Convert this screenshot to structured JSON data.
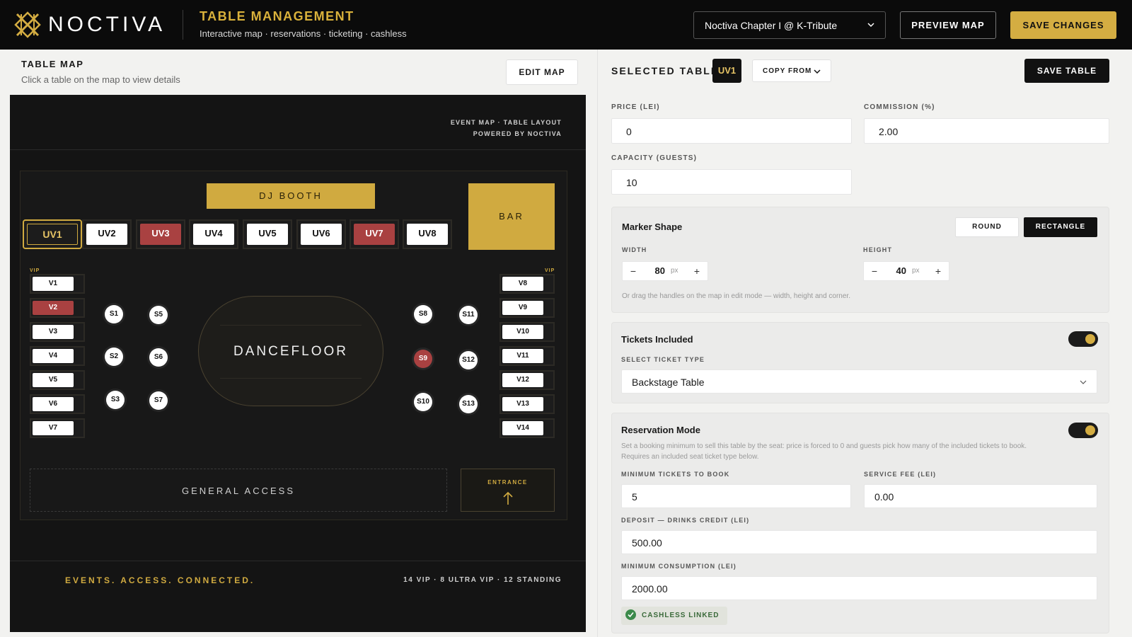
{
  "header": {
    "brand": "NOCTIVA",
    "title": "TABLE MANAGEMENT",
    "subtitle": "Interactive map · reservations · ticketing · cashless",
    "event_select": "Noctiva Chapter I @ K-Tribute",
    "preview_label": "PREVIEW MAP",
    "save_label": "SAVE CHANGES"
  },
  "map_panel": {
    "title": "TABLE MAP",
    "subtitle": "Click a table on the map to view details",
    "edit_label": "EDIT MAP",
    "map_header_line1": "EVENT MAP · TABLE LAYOUT",
    "map_header_line2": "POWERED BY NOCTIVA",
    "dj_booth": "DJ BOOTH",
    "bar": "BAR",
    "vip_label": "VIP",
    "dancefloor": "DANCEFLOOR",
    "general_access": "GENERAL ACCESS",
    "entrance": "ENTRANCE",
    "tagline": "EVENTS. ACCESS. CONNECTED.",
    "stats": "14 VIP · 8 ULTRA VIP · 12 STANDING",
    "ultra_vip": [
      {
        "label": "UV1",
        "status": "selected"
      },
      {
        "label": "UV2",
        "status": "available"
      },
      {
        "label": "UV3",
        "status": "reserved"
      },
      {
        "label": "UV4",
        "status": "available"
      },
      {
        "label": "UV5",
        "status": "available"
      },
      {
        "label": "UV6",
        "status": "available"
      },
      {
        "label": "UV7",
        "status": "reserved"
      },
      {
        "label": "UV8",
        "status": "available"
      }
    ],
    "vip_left": [
      {
        "label": "V1",
        "status": "available"
      },
      {
        "label": "V2",
        "status": "reserved"
      },
      {
        "label": "V3",
        "status": "available"
      },
      {
        "label": "V4",
        "status": "available"
      },
      {
        "label": "V5",
        "status": "available"
      },
      {
        "label": "V6",
        "status": "available"
      },
      {
        "label": "V7",
        "status": "available"
      }
    ],
    "vip_right": [
      {
        "label": "V8",
        "status": "available"
      },
      {
        "label": "V9",
        "status": "available"
      },
      {
        "label": "V10",
        "status": "available"
      },
      {
        "label": "V11",
        "status": "available"
      },
      {
        "label": "V12",
        "status": "available"
      },
      {
        "label": "V13",
        "status": "available"
      },
      {
        "label": "V14",
        "status": "available"
      }
    ],
    "standing": [
      {
        "label": "S1",
        "status": "available"
      },
      {
        "label": "S2",
        "status": "available"
      },
      {
        "label": "S3",
        "status": "available"
      },
      {
        "label": "S5",
        "status": "available"
      },
      {
        "label": "S6",
        "status": "available"
      },
      {
        "label": "S7",
        "status": "available"
      },
      {
        "label": "S8",
        "status": "available"
      },
      {
        "label": "S9",
        "status": "reserved"
      },
      {
        "label": "S10",
        "status": "available"
      },
      {
        "label": "S11",
        "status": "available"
      },
      {
        "label": "S12",
        "status": "available"
      },
      {
        "label": "S13",
        "status": "available"
      }
    ]
  },
  "details": {
    "title": "SELECTED TABLE",
    "selected": "UV1",
    "copy_from": "COPY FROM",
    "save_table": "SAVE TABLE",
    "price_label": "PRICE (LEI)",
    "price": "0",
    "commission_label": "COMMISSION (%)",
    "commission": "2.00",
    "capacity_label": "CAPACITY (GUESTS)",
    "capacity": "10",
    "marker": {
      "title": "Marker Shape",
      "round": "ROUND",
      "rectangle": "RECTANGLE",
      "selected_shape": "RECTANGLE",
      "width_label": "WIDTH",
      "width": "80",
      "height_label": "HEIGHT",
      "height": "40",
      "unit": "px",
      "minus": "−",
      "plus": "+",
      "hint": "Or drag the handles on the map in edit mode — width, height and corner."
    },
    "tickets": {
      "title": "Tickets Included",
      "enabled": true,
      "type_label": "SELECT TICKET TYPE",
      "type": "Backstage Table"
    },
    "reservation": {
      "title": "Reservation Mode",
      "enabled": true,
      "desc_line1": "Set a booking minimum to sell this table by the seat: price is forced to 0 and guests pick how many of the included tickets to book.",
      "desc_line2": "Requires an included seat ticket type below.",
      "min_tickets_label": "MINIMUM TICKETS TO BOOK",
      "min_tickets": "5",
      "service_fee_label": "SERVICE FEE (LEI)",
      "service_fee": "0.00",
      "deposit_label": "DEPOSIT — DRINKS CREDIT (LEI)",
      "deposit": "500.00",
      "min_consumption_label": "MINIMUM CONSUMPTION (LEI)",
      "min_consumption": "2000.00",
      "cashless": "CASHLESS LINKED"
    }
  },
  "colors": {
    "accent": "#d4ad42",
    "reserved": "#a94141",
    "dark": "#0b0b0b"
  }
}
